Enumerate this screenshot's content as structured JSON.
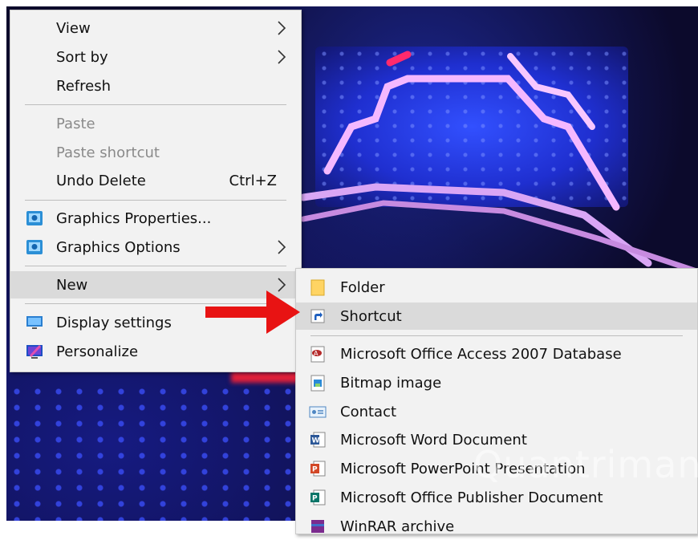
{
  "context_menu": {
    "items": [
      {
        "label": "View",
        "submenu": true
      },
      {
        "label": "Sort by",
        "submenu": true
      },
      {
        "label": "Refresh"
      },
      {
        "label": "Paste",
        "disabled": true
      },
      {
        "label": "Paste shortcut",
        "disabled": true
      },
      {
        "label": "Undo Delete",
        "shortcut": "Ctrl+Z"
      },
      {
        "label": "Graphics Properties...",
        "icon": "intel-graphics-icon"
      },
      {
        "label": "Graphics Options",
        "icon": "intel-graphics-icon",
        "submenu": true
      },
      {
        "label": "New",
        "submenu": true,
        "highlighted": true
      },
      {
        "label": "Display settings",
        "icon": "display-monitor-icon"
      },
      {
        "label": "Personalize",
        "icon": "personalize-icon"
      }
    ]
  },
  "new_submenu": {
    "items": [
      {
        "label": "Folder",
        "icon": "folder-icon"
      },
      {
        "label": "Shortcut",
        "icon": "shortcut-icon",
        "highlighted": true
      },
      {
        "label": "Microsoft Office Access 2007 Database",
        "icon": "access-icon"
      },
      {
        "label": "Bitmap image",
        "icon": "bitmap-icon"
      },
      {
        "label": "Contact",
        "icon": "contact-icon"
      },
      {
        "label": "Microsoft Word Document",
        "icon": "word-icon"
      },
      {
        "label": "Microsoft PowerPoint Presentation",
        "icon": "powerpoint-icon"
      },
      {
        "label": "Microsoft Office Publisher Document",
        "icon": "publisher-icon"
      },
      {
        "label": "WinRAR archive",
        "icon": "winrar-icon"
      }
    ]
  },
  "watermark": "Quantrimang",
  "colors": {
    "menu_bg": "#f2f2f2",
    "highlight": "#dadada",
    "arrow": "#e81313",
    "disabled_text": "#8a8a8a"
  }
}
